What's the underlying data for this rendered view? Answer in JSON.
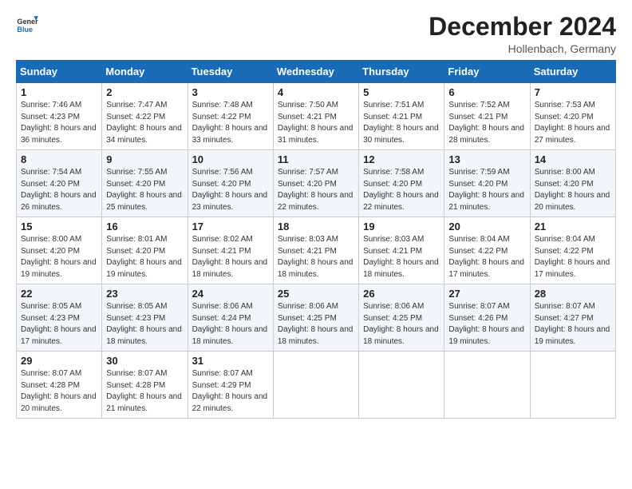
{
  "header": {
    "logo_general": "General",
    "logo_blue": "Blue",
    "title": "December 2024",
    "location": "Hollenbach, Germany"
  },
  "days_of_week": [
    "Sunday",
    "Monday",
    "Tuesday",
    "Wednesday",
    "Thursday",
    "Friday",
    "Saturday"
  ],
  "weeks": [
    [
      {
        "day": "1",
        "sunrise": "Sunrise: 7:46 AM",
        "sunset": "Sunset: 4:23 PM",
        "daylight": "Daylight: 8 hours and 36 minutes."
      },
      {
        "day": "2",
        "sunrise": "Sunrise: 7:47 AM",
        "sunset": "Sunset: 4:22 PM",
        "daylight": "Daylight: 8 hours and 34 minutes."
      },
      {
        "day": "3",
        "sunrise": "Sunrise: 7:48 AM",
        "sunset": "Sunset: 4:22 PM",
        "daylight": "Daylight: 8 hours and 33 minutes."
      },
      {
        "day": "4",
        "sunrise": "Sunrise: 7:50 AM",
        "sunset": "Sunset: 4:21 PM",
        "daylight": "Daylight: 8 hours and 31 minutes."
      },
      {
        "day": "5",
        "sunrise": "Sunrise: 7:51 AM",
        "sunset": "Sunset: 4:21 PM",
        "daylight": "Daylight: 8 hours and 30 minutes."
      },
      {
        "day": "6",
        "sunrise": "Sunrise: 7:52 AM",
        "sunset": "Sunset: 4:21 PM",
        "daylight": "Daylight: 8 hours and 28 minutes."
      },
      {
        "day": "7",
        "sunrise": "Sunrise: 7:53 AM",
        "sunset": "Sunset: 4:20 PM",
        "daylight": "Daylight: 8 hours and 27 minutes."
      }
    ],
    [
      {
        "day": "8",
        "sunrise": "Sunrise: 7:54 AM",
        "sunset": "Sunset: 4:20 PM",
        "daylight": "Daylight: 8 hours and 26 minutes."
      },
      {
        "day": "9",
        "sunrise": "Sunrise: 7:55 AM",
        "sunset": "Sunset: 4:20 PM",
        "daylight": "Daylight: 8 hours and 25 minutes."
      },
      {
        "day": "10",
        "sunrise": "Sunrise: 7:56 AM",
        "sunset": "Sunset: 4:20 PM",
        "daylight": "Daylight: 8 hours and 23 minutes."
      },
      {
        "day": "11",
        "sunrise": "Sunrise: 7:57 AM",
        "sunset": "Sunset: 4:20 PM",
        "daylight": "Daylight: 8 hours and 22 minutes."
      },
      {
        "day": "12",
        "sunrise": "Sunrise: 7:58 AM",
        "sunset": "Sunset: 4:20 PM",
        "daylight": "Daylight: 8 hours and 22 minutes."
      },
      {
        "day": "13",
        "sunrise": "Sunrise: 7:59 AM",
        "sunset": "Sunset: 4:20 PM",
        "daylight": "Daylight: 8 hours and 21 minutes."
      },
      {
        "day": "14",
        "sunrise": "Sunrise: 8:00 AM",
        "sunset": "Sunset: 4:20 PM",
        "daylight": "Daylight: 8 hours and 20 minutes."
      }
    ],
    [
      {
        "day": "15",
        "sunrise": "Sunrise: 8:00 AM",
        "sunset": "Sunset: 4:20 PM",
        "daylight": "Daylight: 8 hours and 19 minutes."
      },
      {
        "day": "16",
        "sunrise": "Sunrise: 8:01 AM",
        "sunset": "Sunset: 4:20 PM",
        "daylight": "Daylight: 8 hours and 19 minutes."
      },
      {
        "day": "17",
        "sunrise": "Sunrise: 8:02 AM",
        "sunset": "Sunset: 4:21 PM",
        "daylight": "Daylight: 8 hours and 18 minutes."
      },
      {
        "day": "18",
        "sunrise": "Sunrise: 8:03 AM",
        "sunset": "Sunset: 4:21 PM",
        "daylight": "Daylight: 8 hours and 18 minutes."
      },
      {
        "day": "19",
        "sunrise": "Sunrise: 8:03 AM",
        "sunset": "Sunset: 4:21 PM",
        "daylight": "Daylight: 8 hours and 18 minutes."
      },
      {
        "day": "20",
        "sunrise": "Sunrise: 8:04 AM",
        "sunset": "Sunset: 4:22 PM",
        "daylight": "Daylight: 8 hours and 17 minutes."
      },
      {
        "day": "21",
        "sunrise": "Sunrise: 8:04 AM",
        "sunset": "Sunset: 4:22 PM",
        "daylight": "Daylight: 8 hours and 17 minutes."
      }
    ],
    [
      {
        "day": "22",
        "sunrise": "Sunrise: 8:05 AM",
        "sunset": "Sunset: 4:23 PM",
        "daylight": "Daylight: 8 hours and 17 minutes."
      },
      {
        "day": "23",
        "sunrise": "Sunrise: 8:05 AM",
        "sunset": "Sunset: 4:23 PM",
        "daylight": "Daylight: 8 hours and 18 minutes."
      },
      {
        "day": "24",
        "sunrise": "Sunrise: 8:06 AM",
        "sunset": "Sunset: 4:24 PM",
        "daylight": "Daylight: 8 hours and 18 minutes."
      },
      {
        "day": "25",
        "sunrise": "Sunrise: 8:06 AM",
        "sunset": "Sunset: 4:25 PM",
        "daylight": "Daylight: 8 hours and 18 minutes."
      },
      {
        "day": "26",
        "sunrise": "Sunrise: 8:06 AM",
        "sunset": "Sunset: 4:25 PM",
        "daylight": "Daylight: 8 hours and 18 minutes."
      },
      {
        "day": "27",
        "sunrise": "Sunrise: 8:07 AM",
        "sunset": "Sunset: 4:26 PM",
        "daylight": "Daylight: 8 hours and 19 minutes."
      },
      {
        "day": "28",
        "sunrise": "Sunrise: 8:07 AM",
        "sunset": "Sunset: 4:27 PM",
        "daylight": "Daylight: 8 hours and 19 minutes."
      }
    ],
    [
      {
        "day": "29",
        "sunrise": "Sunrise: 8:07 AM",
        "sunset": "Sunset: 4:28 PM",
        "daylight": "Daylight: 8 hours and 20 minutes."
      },
      {
        "day": "30",
        "sunrise": "Sunrise: 8:07 AM",
        "sunset": "Sunset: 4:28 PM",
        "daylight": "Daylight: 8 hours and 21 minutes."
      },
      {
        "day": "31",
        "sunrise": "Sunrise: 8:07 AM",
        "sunset": "Sunset: 4:29 PM",
        "daylight": "Daylight: 8 hours and 22 minutes."
      },
      null,
      null,
      null,
      null
    ]
  ]
}
